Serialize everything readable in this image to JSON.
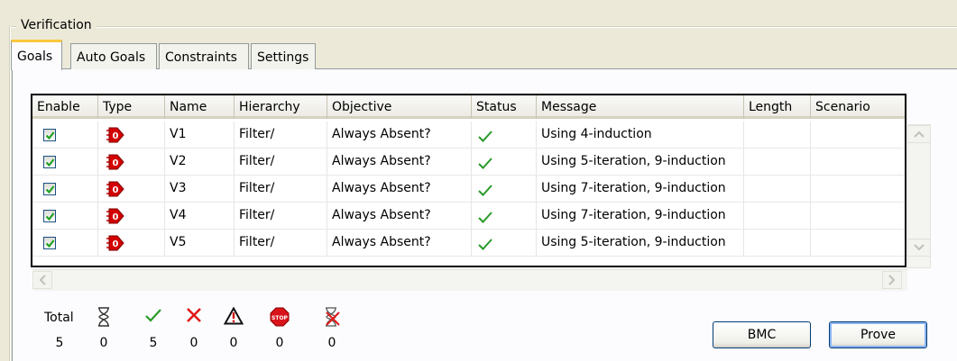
{
  "group": {
    "title": "Verification"
  },
  "tabs": [
    "Goals",
    "Auto Goals",
    "Constraints",
    "Settings"
  ],
  "columns": [
    "Enable",
    "Type",
    "Name",
    "Hierarchy",
    "Objective",
    "Status",
    "Message",
    "Length",
    "Scenario"
  ],
  "rows": [
    {
      "enabled": true,
      "type_icon": "goal-icon",
      "name": "V1",
      "hierarchy": "Filter/",
      "objective": "Always Absent?",
      "status_icon": "check-icon",
      "message": "Using 4-induction",
      "length": "",
      "scenario": ""
    },
    {
      "enabled": true,
      "type_icon": "goal-icon",
      "name": "V2",
      "hierarchy": "Filter/",
      "objective": "Always Absent?",
      "status_icon": "check-icon",
      "message": "Using 5-iteration, 9-induction",
      "length": "",
      "scenario": ""
    },
    {
      "enabled": true,
      "type_icon": "goal-icon",
      "name": "V3",
      "hierarchy": "Filter/",
      "objective": "Always Absent?",
      "status_icon": "check-icon",
      "message": "Using 7-iteration, 9-induction",
      "length": "",
      "scenario": ""
    },
    {
      "enabled": true,
      "type_icon": "goal-icon",
      "name": "V4",
      "hierarchy": "Filter/",
      "objective": "Always Absent?",
      "status_icon": "check-icon",
      "message": "Using 7-iteration, 9-induction",
      "length": "",
      "scenario": ""
    },
    {
      "enabled": true,
      "type_icon": "goal-icon",
      "name": "V5",
      "hierarchy": "Filter/",
      "objective": "Always Absent?",
      "status_icon": "check-icon",
      "message": "Using 5-iteration, 9-induction",
      "length": "",
      "scenario": ""
    }
  ],
  "summary": {
    "total_label": "Total",
    "total": "5",
    "counts": [
      {
        "icon": "hourglass-icon",
        "value": "0"
      },
      {
        "icon": "check-icon",
        "value": "5"
      },
      {
        "icon": "cross-icon",
        "value": "0"
      },
      {
        "icon": "warning-icon",
        "value": "0"
      },
      {
        "icon": "stop-icon",
        "value": "0"
      },
      {
        "icon": "hourglass-cancel-icon",
        "value": "0"
      }
    ]
  },
  "buttons": {
    "bmc": "BMC",
    "prove": "Prove"
  },
  "colors": {
    "tab_accent": "#ffc83c",
    "check": "#2a9a2a",
    "cross": "#e01818",
    "goal_icon": "#cc0000",
    "window_bg": "#ece9d8"
  }
}
